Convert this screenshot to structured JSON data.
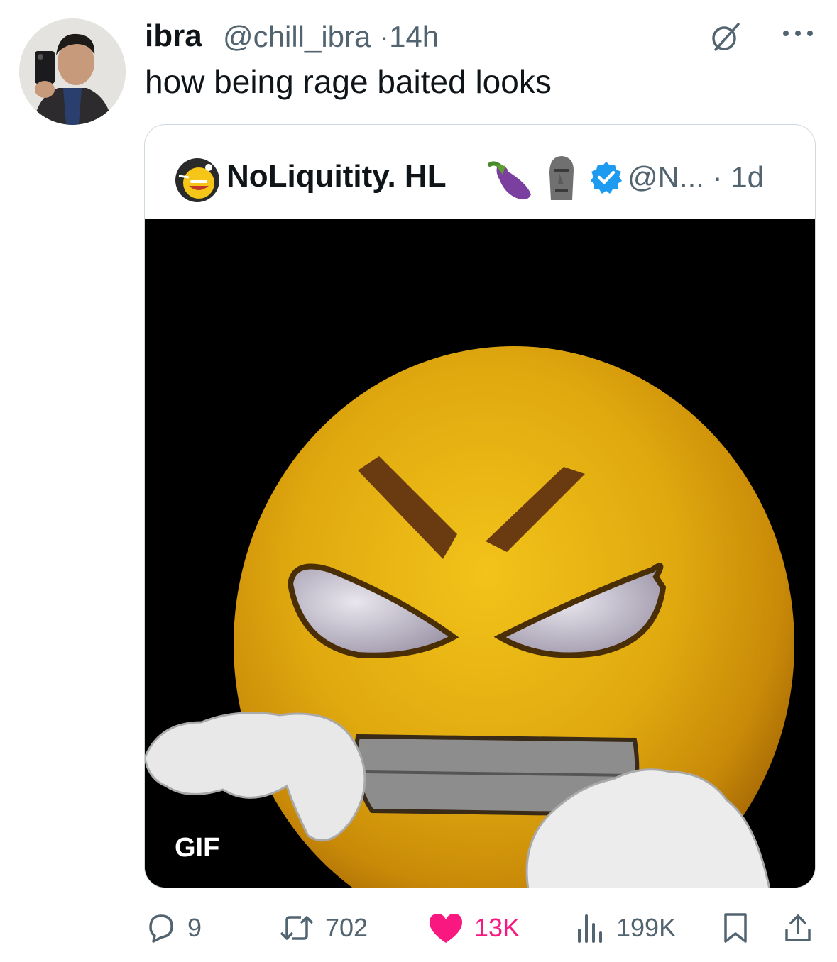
{
  "tweet": {
    "author_name": "ibra",
    "author_handle": "@chill_ibra",
    "separator": "·",
    "time": "14h",
    "text": "how being rage baited looks",
    "icons": {
      "grok": "grok-icon",
      "more": "more-icon"
    }
  },
  "quoted": {
    "name": "NoLiquitity. HL",
    "emojis": [
      "eggplant-emoji",
      "moai-emoji"
    ],
    "verified": true,
    "handle": "@N...",
    "separator": "·",
    "time": "1d",
    "media_badge": "GIF",
    "media_description_icon": "angry-emoji-gif"
  },
  "actions": {
    "replies": "9",
    "reposts": "702",
    "likes": "13K",
    "liked": true,
    "views": "199K",
    "like_color": "#f91880",
    "muted_color": "#536471",
    "accent_color": "#1d9bf0"
  }
}
